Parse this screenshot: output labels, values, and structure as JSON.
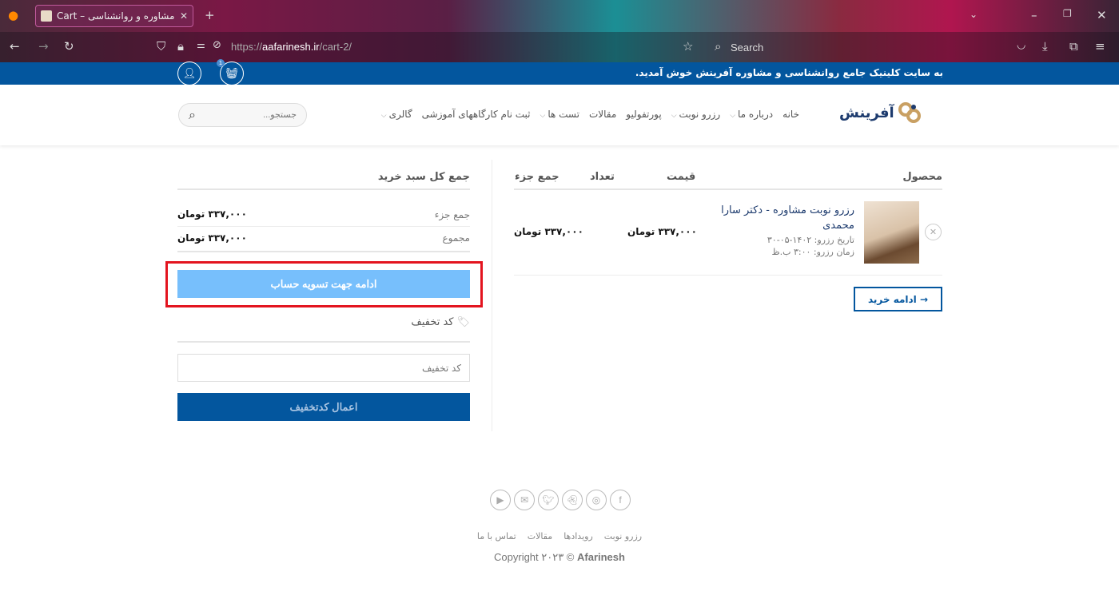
{
  "browser": {
    "tab_title": "Cart – آفرینش مشاوره و روانشناسی",
    "url_prefix": "https://",
    "url_domain": "aafarinesh.ir",
    "url_path": "/cart-2/",
    "search_label": "Search"
  },
  "topbar": {
    "welcome": "به سایت کلینیک جامع روانشناسی و مشاوره آفرینش خوش آمدید.",
    "cart_count": "1"
  },
  "header": {
    "logo_text": "آفرینش",
    "nav": [
      {
        "label": "خانه",
        "dropdown": false
      },
      {
        "label": "درباره ما",
        "dropdown": true
      },
      {
        "label": "رزرو نوبت",
        "dropdown": true
      },
      {
        "label": "پورتفولیو",
        "dropdown": false
      },
      {
        "label": "مقالات",
        "dropdown": false
      },
      {
        "label": "تست ها",
        "dropdown": true
      },
      {
        "label": "ثبت نام کارگاههای آموزشی",
        "dropdown": false
      },
      {
        "label": "گالری",
        "dropdown": true
      }
    ],
    "search_placeholder": "جستجو..."
  },
  "cart": {
    "columns": {
      "product": "محصول",
      "price": "قیمت",
      "quantity": "تعداد",
      "subtotal": "جمع جزء"
    },
    "item": {
      "name": "رزرو نوبت مشاوره - دکتر سارا محمدی",
      "date_label": "تاریخ رزرو:",
      "date_value": "۱۴۰۲-۰۵-۳۰",
      "time_label": "زمان رزرو:",
      "time_value": "۳:۰۰ ب.ظ",
      "price": "۳۳۷,۰۰۰ تومان",
      "subtotal": "۳۳۷,۰۰۰ تومان"
    },
    "continue_shopping": "→ ادامه خرید"
  },
  "totals": {
    "title": "جمع کل سبد خرید",
    "subtotal_label": "جمع جزء",
    "subtotal_value": "۳۳۷,۰۰۰ تومان",
    "total_label": "مجموع",
    "total_value": "۳۳۷,۰۰۰ تومان",
    "checkout_button": "ادامه جهت تسویه حساب",
    "coupon_heading": "کد تخفیف",
    "coupon_placeholder": "کد تخفیف",
    "apply_button": "اعمال کدتخفیف"
  },
  "colors": {
    "brand_blue": "#03569e",
    "checkout_blue": "#77bffc",
    "highlight_red": "#e3141f"
  },
  "footer": {
    "social_icons": [
      "youtube-icon",
      "email-icon",
      "twitter-icon",
      "snapchat-icon",
      "instagram-icon",
      "facebook-icon"
    ],
    "links": [
      "رزرو نوبت",
      "رویدادها",
      "مقالات",
      "تماس با ما"
    ],
    "copyright_prefix": "Copyright ۲۰۲۳ © ",
    "copyright_brand": "Afarinesh"
  }
}
